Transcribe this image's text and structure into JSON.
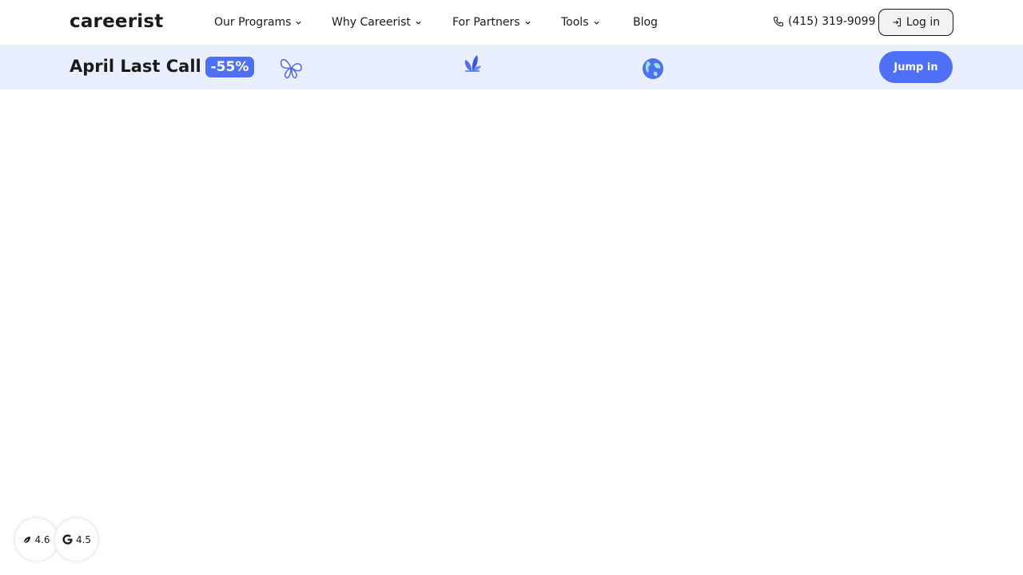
{
  "header": {
    "logo": "careerist",
    "nav": [
      {
        "label": "Our Programs",
        "dropdown": true
      },
      {
        "label": "Why Careerist",
        "dropdown": true
      },
      {
        "label": "For Partners",
        "dropdown": true
      },
      {
        "label": "Tools",
        "dropdown": true
      },
      {
        "label": "Blog",
        "dropdown": false
      }
    ],
    "phone": "(415) 319-9099",
    "login_label": "Log in"
  },
  "promo": {
    "title": "April Last Call",
    "discount": "-55%",
    "cta_label": "Jump in",
    "decorations": [
      "butterfly-icon",
      "leaves-icon",
      "globe-icon"
    ],
    "accent_color": "#4e6ff7",
    "background_color": "#e9efff"
  },
  "ratings": [
    {
      "source_icon": "leaf-icon",
      "value": "4.6"
    },
    {
      "source_icon": "google-icon",
      "value": "4.5"
    }
  ]
}
